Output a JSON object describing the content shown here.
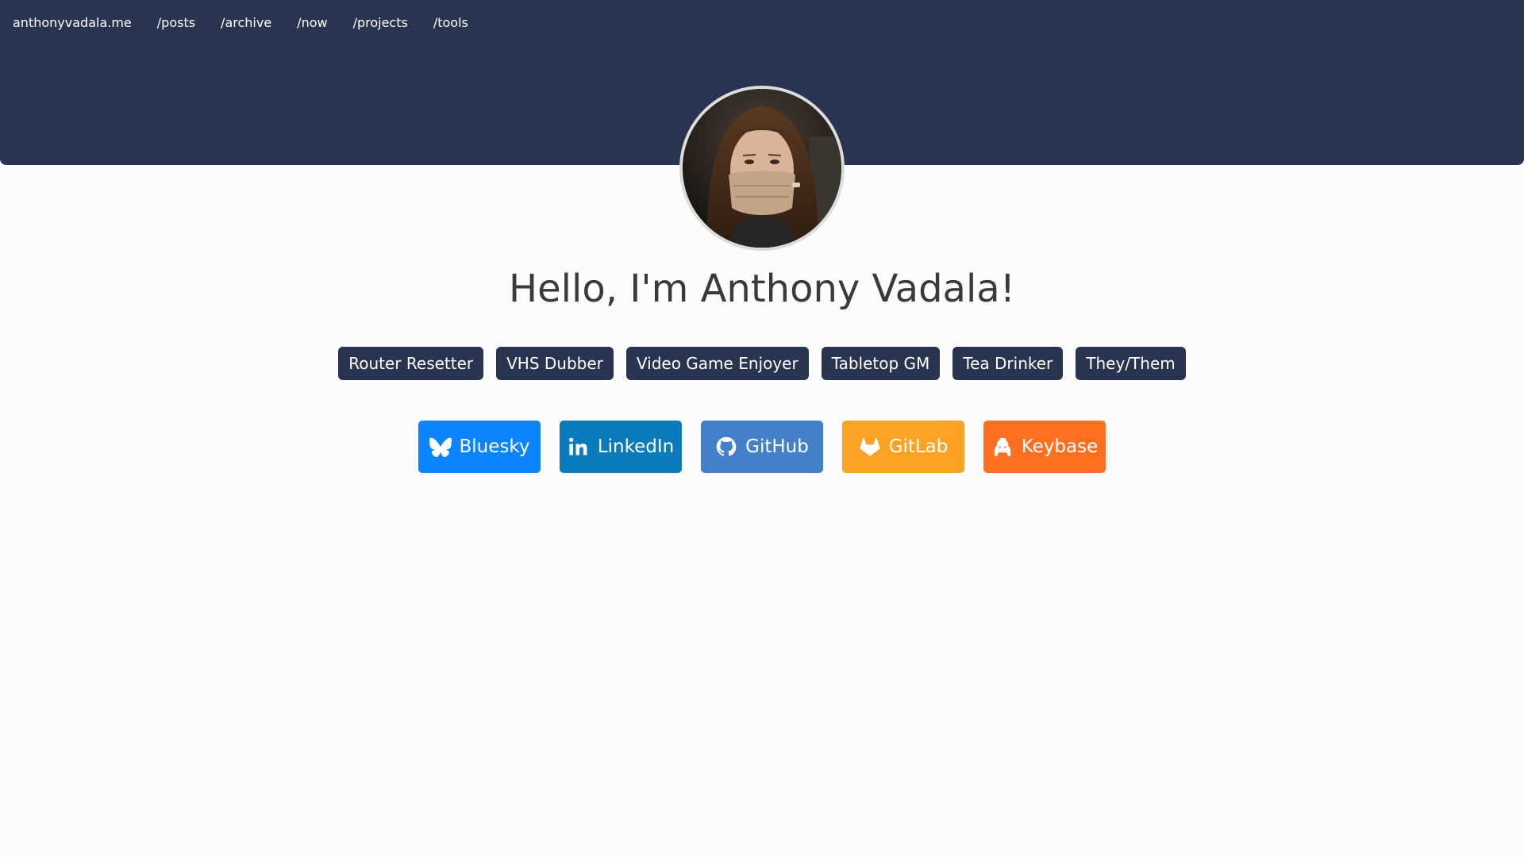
{
  "nav": {
    "site": "anthonyvadala.me",
    "links": [
      "/posts",
      "/archive",
      "/now",
      "/projects",
      "/tools"
    ]
  },
  "hero": {
    "title": "Hello, I'm Anthony Vadala!",
    "tags": [
      "Router Resetter",
      "VHS Dubber",
      "Video Game Enjoyer",
      "Tabletop GM",
      "Tea Drinker",
      "They/Them"
    ]
  },
  "socials": [
    {
      "label": "Bluesky",
      "icon": "butterfly-icon",
      "color": "#0a85ff"
    },
    {
      "label": "LinkedIn",
      "icon": "linkedin-icon",
      "color": "#0a7bbd"
    },
    {
      "label": "GitHub",
      "icon": "github-icon",
      "color": "#4480c9"
    },
    {
      "label": "GitLab",
      "icon": "gitlab-icon",
      "color": "#fca326"
    },
    {
      "label": "Keybase",
      "icon": "keybase-icon",
      "color": "#ff6f21"
    }
  ],
  "colors": {
    "header": "#283450",
    "tag_bg": "#283450",
    "page_bg": "#fcfcfc",
    "title_text": "#3a3a3a"
  }
}
